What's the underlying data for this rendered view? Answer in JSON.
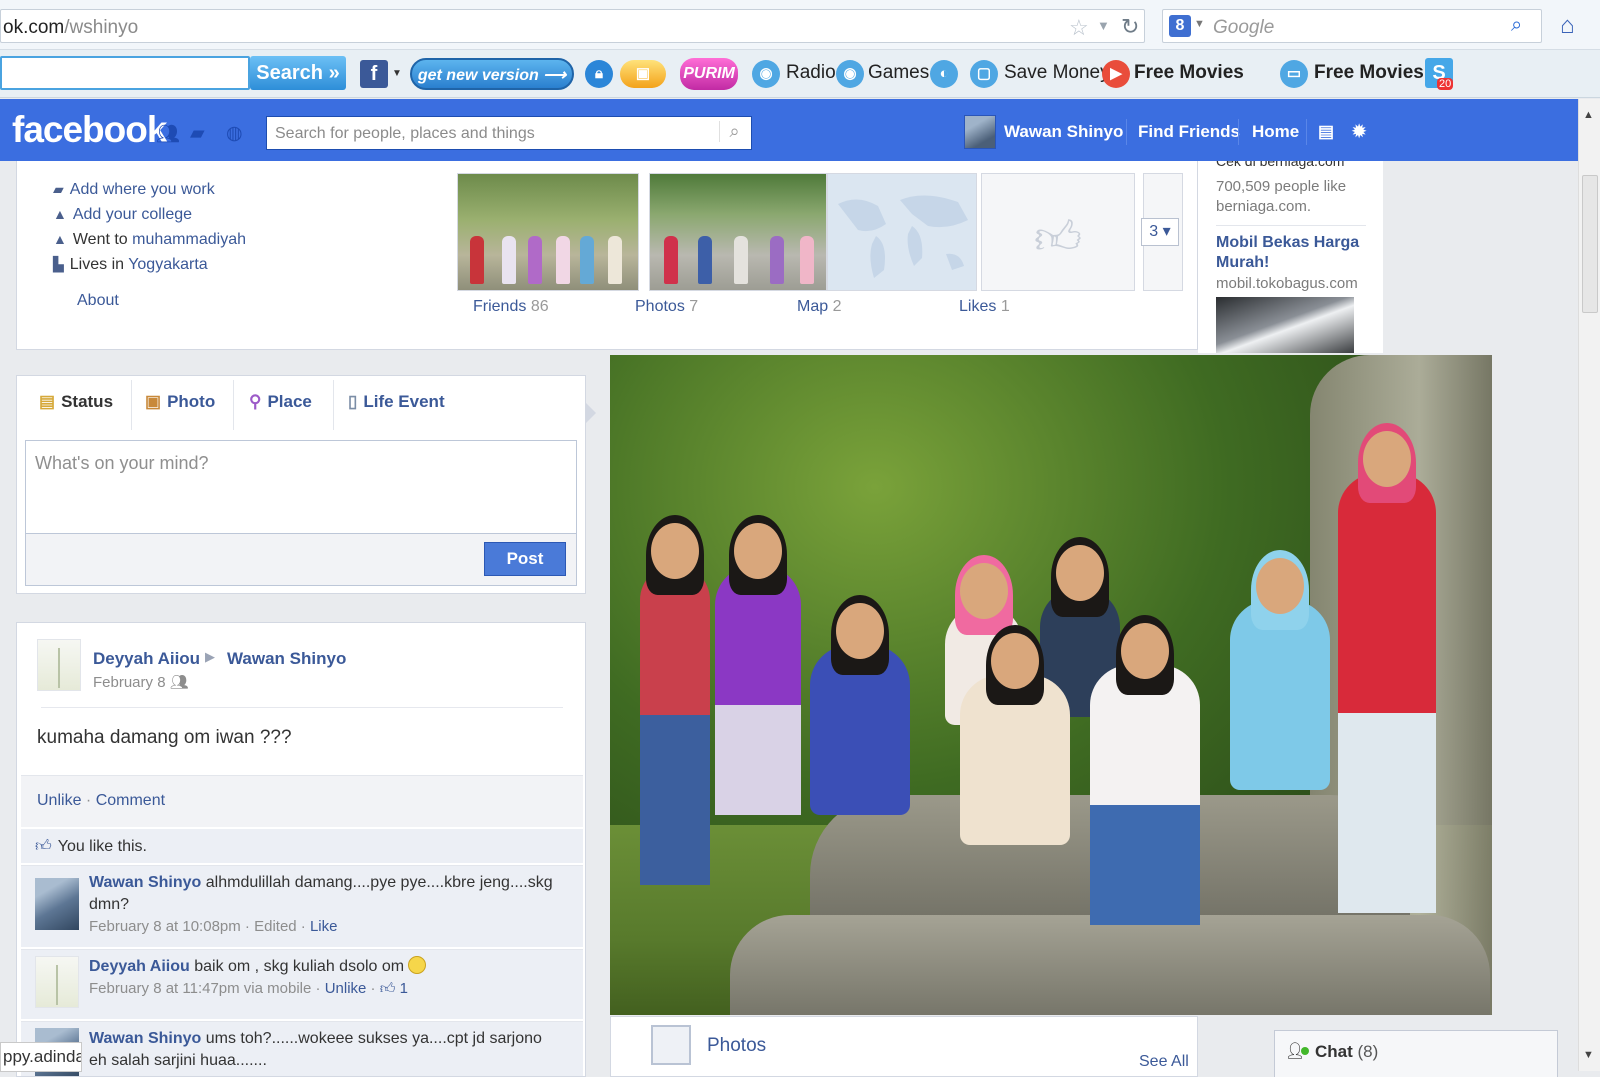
{
  "browser": {
    "url_host": "ok.com",
    "url_path": "/wshinyo",
    "search_placeholder": "Google"
  },
  "toolbar": {
    "search_button": "Search »",
    "get_new_version": "get new version ⟶",
    "purim": "PURIM",
    "radio": "Radio",
    "games": "Games",
    "save_money": "Save Money",
    "free_movies_1": "Free Movies",
    "free_movies_2": "Free Movies",
    "s_badge": "20"
  },
  "facebook": {
    "logo": "facebook",
    "search_placeholder": "Search for people, places and things",
    "user_name": "Wawan Shinyo",
    "find_friends": "Find Friends",
    "home": "Home"
  },
  "about": {
    "work": "Add where you work",
    "college": "Add your college",
    "went_to_prefix": "Went to ",
    "went_to_school": "muhammadiyah",
    "lives_in_prefix": "Lives in ",
    "lives_in_city": "Yogyakarta",
    "about_link": "About"
  },
  "tiles": {
    "friends_label": "Friends",
    "friends_count": "86",
    "photos_label": "Photos",
    "photos_count": "7",
    "map_label": "Map",
    "map_count": "2",
    "likes_label": "Likes",
    "likes_count": "1",
    "more_count": "3"
  },
  "ads": {
    "cut_text": "Cek di berniaga.com",
    "likes_text": "700,509 people like berniaga.com.",
    "title": "Mobil Bekas Harga Murah!",
    "url": "mobil.tokobagus.com"
  },
  "composer": {
    "tab_status": "Status",
    "tab_photo": "Photo",
    "tab_place": "Place",
    "tab_life_event": "Life Event",
    "placeholder": "What's on your mind?",
    "post_button": "Post"
  },
  "post": {
    "author": "Deyyah Aiiou",
    "target": "Wawan Shinyo",
    "date": "February 8",
    "text": "kumaha damang om iwan ???",
    "unlike": "Unlike",
    "comment": "Comment",
    "you_like": "You like this.",
    "comments": [
      {
        "author": "Wawan Shinyo",
        "text": " alhmdulillah damang....pye pye....kbre jeng....skg dmn?",
        "time": "February 8 at 10:08pm",
        "extra": " · Edited · ",
        "action": "Like",
        "like_count": ""
      },
      {
        "author": "Deyyah Aiiou",
        "text": " baik om , skg kuliah dsolo om",
        "time": "February 8 at 11:47pm via mobile",
        "extra": " · ",
        "action": "Unlike",
        "like_count": "1"
      },
      {
        "author": "Wawan Shinyo",
        "text": " ums toh?......wokeee sukses ya....cpt jd sarjono eh salah sarjini huaa.......",
        "time": "",
        "extra": "",
        "action": "",
        "like_count": ""
      }
    ]
  },
  "photos_strip": {
    "label": "Photos",
    "see_all": "See All"
  },
  "chat": {
    "label": "Chat",
    "count": "(8)"
  },
  "status_left": "ppy.adinda",
  "colors": {
    "fb_blue": "#3b6ee0",
    "link_blue": "#3b5998",
    "page_bg": "#e9ebee"
  }
}
